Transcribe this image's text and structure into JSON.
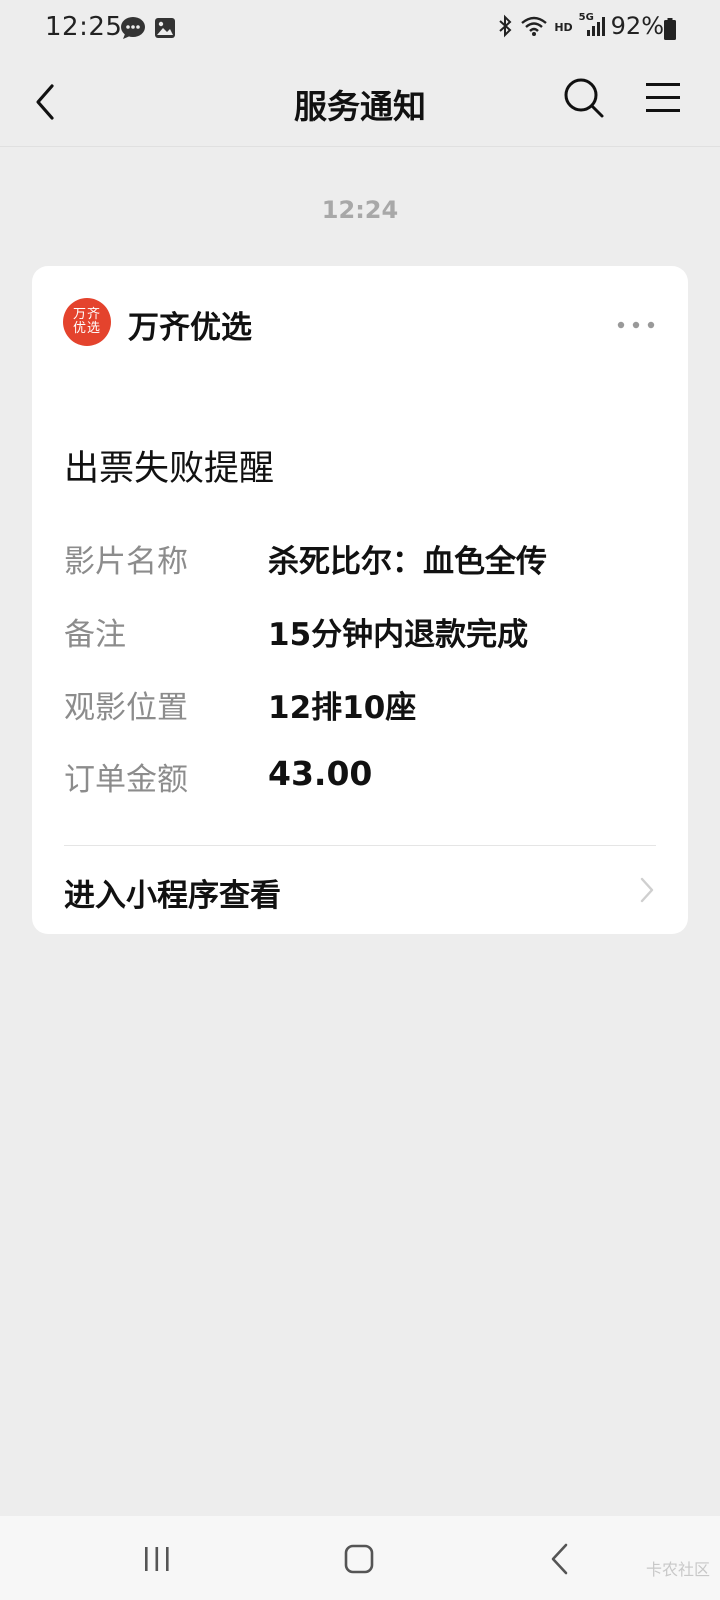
{
  "status_bar": {
    "time": "12:25",
    "network_label": "HD",
    "network_gen": "5G",
    "battery_percent": "92%",
    "icons": [
      "chat-bubble-icon",
      "image-icon",
      "bluetooth-icon",
      "wifi-icon",
      "signal-icon",
      "battery-icon"
    ]
  },
  "nav": {
    "title": "服务通知",
    "back_icon": "chevron-left-icon",
    "search_icon": "search-icon",
    "menu_icon": "menu-icon"
  },
  "message": {
    "timestamp": "12:24",
    "card": {
      "logo_text": "万齐优选",
      "source_name": "万齐优选",
      "more_icon": "more-dots-icon",
      "title": "出票失败提醒",
      "rows": [
        {
          "label": "影片名称",
          "value": "杀死比尔：血色全传"
        },
        {
          "label": "备注",
          "value": "15分钟内退款完成"
        },
        {
          "label": "观影位置",
          "value": "12排10座"
        },
        {
          "label": "订单金额",
          "value": "43.00"
        }
      ],
      "action_label": "进入小程序查看"
    }
  },
  "system_nav": {
    "icons": [
      "recent-apps-icon",
      "home-icon",
      "back-icon"
    ]
  },
  "watermark": "卡农社区",
  "colors": {
    "background": "#ededed",
    "card": "#ffffff",
    "logo": "#e4432d",
    "label_gray": "#8c8c8c",
    "timestamp_gray": "#a8a8a8"
  }
}
